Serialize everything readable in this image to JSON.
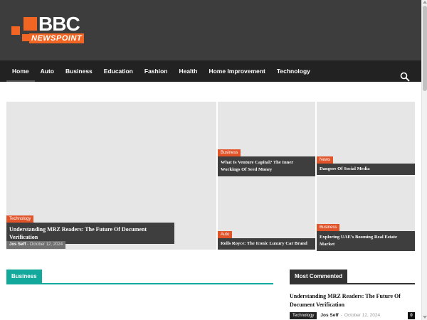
{
  "logo": {
    "bbc": "BBC",
    "newspoint": "NEWSPOINT",
    "accent": "#f26522"
  },
  "nav": {
    "items": [
      "Home",
      "Auto",
      "Business",
      "Education",
      "Fashion",
      "Health",
      "Home Improvement",
      "Technology"
    ],
    "active": "Home",
    "search_icon": "search-icon"
  },
  "featured": {
    "main": {
      "tag": "Technology",
      "title": "Understanding MRZ Readers: The Future Of Document Verification",
      "author": "Jos Seff",
      "separator": "-",
      "date": "October 12, 2024"
    },
    "tiles": [
      {
        "tag": "Business",
        "title": "What Is Venture Capital? The Inner Workings Of Seed Money"
      },
      {
        "tag": "News",
        "title": "Dangers Of Social Media"
      },
      {
        "tag": "Auto",
        "title": "Rolls Royce: The Iconic Luxury Car Brand"
      },
      {
        "tag": "Business",
        "title": "Exploring UAE’s Booming Real Estate Market"
      }
    ]
  },
  "sections": {
    "business": {
      "label": "Business",
      "color": "#12a89c"
    },
    "most_commented": {
      "label": "Most Commented",
      "color": "#333333",
      "post": {
        "title": "Understanding MRZ Readers: The Future Of Document Verification",
        "tag": "Technology",
        "author": "Jos Seff",
        "separator": "-",
        "date": "October 12, 2024",
        "comments": "0"
      }
    }
  }
}
